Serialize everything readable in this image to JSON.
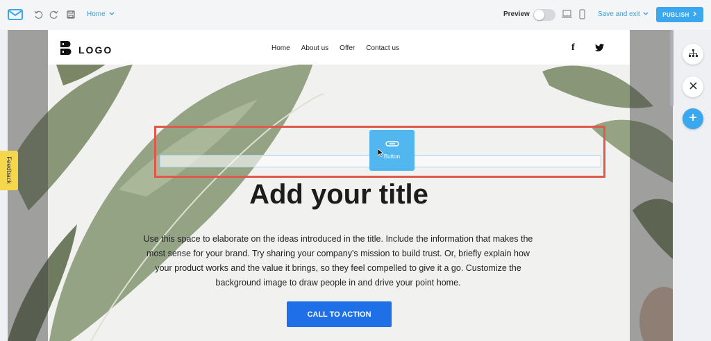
{
  "toolbar": {
    "page_select": "Home",
    "preview_label": "Preview",
    "save_exit_label": "Save and exit",
    "publish_label": "PUBLISH"
  },
  "page": {
    "logo_text": "LOGO",
    "nav": [
      "Home",
      "About us",
      "Offer",
      "Contact us"
    ],
    "social": {
      "facebook": "f"
    },
    "drag_button_label": "Button",
    "title": "Add your title",
    "body": "Use this space to elaborate on the ideas introduced in the title. Include the information that makes the most sense for your brand. Try sharing your company's mission to build trust. Or, briefly explain how your product works and the value it brings, so they feel compelled to give it a go. Customize the background image to draw people in and drive your point home.",
    "cta_label": "CALL TO ACTION"
  },
  "feedback_label": "Feedback",
  "colors": {
    "accent": "#3aa7ee",
    "cta": "#1f6fe6",
    "selection": "#e2574c",
    "feedback": "#f5d74b"
  }
}
